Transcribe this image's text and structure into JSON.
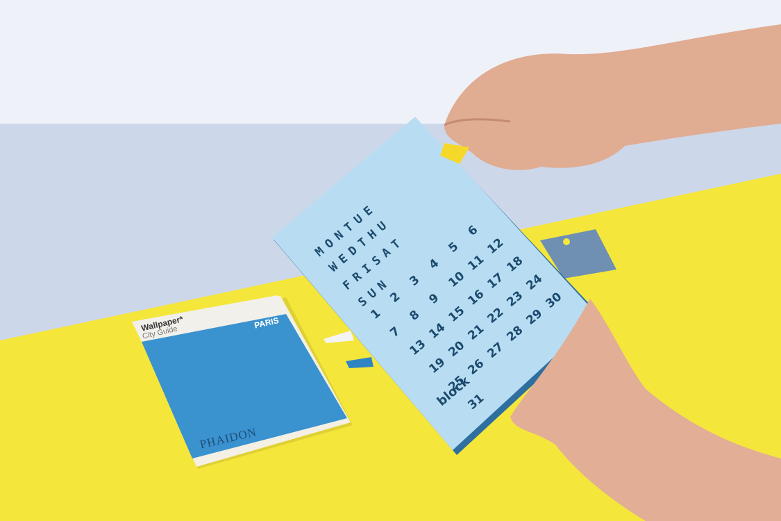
{
  "book": {
    "title": "Wallpaper*",
    "subtitle": "City Guide",
    "city": "PARIS",
    "publisher": "PHAIDON"
  },
  "calendar": {
    "weekday_letters": [
      "MONTUE",
      "WEDTHU",
      "FRISAT",
      "SUN"
    ],
    "numbers": [
      "1",
      "2",
      "3",
      "4",
      "5",
      "6",
      "7",
      "8",
      "9",
      "10",
      "11",
      "12",
      "13",
      "14",
      "15",
      "16",
      "17",
      "18",
      "19",
      "20",
      "21",
      "22",
      "23",
      "24",
      "25",
      "26",
      "27",
      "28",
      "29",
      "30",
      "31"
    ],
    "brand": "block"
  },
  "colors": {
    "wall": "#eff1f8",
    "table_band": "#cdd7ea",
    "desk_yellow": "#f5e63c",
    "calendar_card": "#b8ddf2",
    "calendar_ink": "#1c4a6e",
    "book_blue": "#3a92cf",
    "tag_grey": "#6f8fb3",
    "skin": "#e0ac92"
  }
}
